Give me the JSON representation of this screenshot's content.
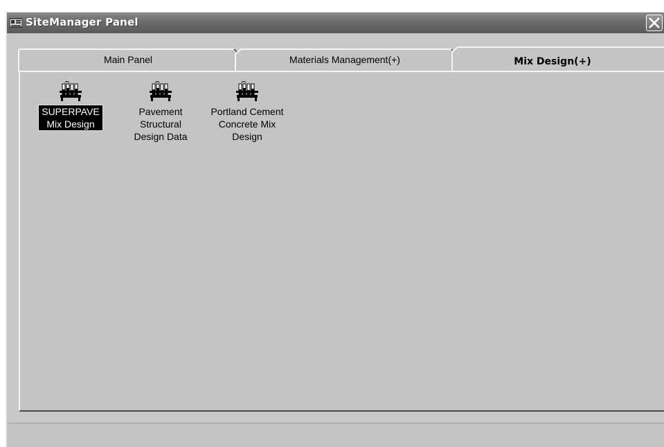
{
  "window": {
    "title": "SiteManager Panel",
    "app_icon": "sitemanager-app-icon",
    "close_icon": "close-icon"
  },
  "tabs": [
    {
      "label": "Main Panel",
      "active": false
    },
    {
      "label": "Materials Management(+)",
      "active": false
    },
    {
      "label": "Mix Design(+)",
      "active": true
    }
  ],
  "items": [
    {
      "label": "SUPERPAVE\nMix Design",
      "icon": "test-tubes-rack-icon",
      "selected": true
    },
    {
      "label": "Pavement\nStructural\nDesign Data",
      "icon": "test-tubes-rack-icon",
      "selected": false
    },
    {
      "label": "Portland Cement\nConcrete Mix\nDesign",
      "icon": "test-tubes-rack-icon",
      "selected": false
    }
  ],
  "colors": {
    "titlebar": "#6e6e6e",
    "panel": "#c4c4c4",
    "selection": "#000000"
  }
}
